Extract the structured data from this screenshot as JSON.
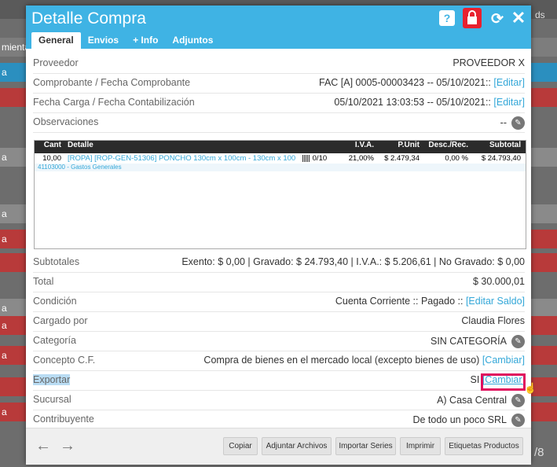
{
  "background": {
    "left_labels": [
      "mienta",
      "a",
      "a",
      "a",
      "a",
      "a",
      "a",
      "a",
      "a"
    ],
    "right_fragment": "/8",
    "row_fragment": "ds"
  },
  "dialog": {
    "title": "Detalle Compra",
    "tabs": [
      "General",
      "Envios",
      "+ Info",
      "Adjuntos"
    ],
    "active_tab": "General",
    "header_icons": [
      "help-icon",
      "lock-icon",
      "refresh-icon",
      "close-icon"
    ],
    "accent": "#3fb3e4"
  },
  "fields": {
    "proveedor": {
      "label": "Proveedor",
      "value": "PROVEEDOR X"
    },
    "comprobante": {
      "label": "Comprobante / Fecha Comprobante",
      "value": "FAC [A] 0005-00003423 -- 05/10/2021::",
      "link": "[Editar]"
    },
    "fecha_carga": {
      "label": "Fecha Carga / Fecha Contabilización",
      "value": "05/10/2021 13:03:53 -- 05/10/2021::",
      "link": "[Editar]"
    },
    "observaciones": {
      "label": "Observaciones",
      "value": "--"
    }
  },
  "grid": {
    "headers": [
      "Cant",
      "Detalle",
      "I.V.A.",
      "P.Unit",
      "Desc./Rec.",
      "Subtotal"
    ],
    "rows": [
      {
        "cant": "10,00",
        "detalle": "[ROPA] [ROP-GEN-51306] PONCHO 130cm x 100cm - 130cm x 100",
        "series": "0/10",
        "iva": "21,00%",
        "punit": "$ 2.479,34",
        "desc": "0,00 %",
        "subtotal": "$ 24.793,40",
        "cuenta": "41103000 - Gastos Generales"
      }
    ]
  },
  "summary": {
    "subtotales": {
      "label": "Subtotales",
      "value": "Exento: $ 0,00 | Gravado: $ 24.793,40 | I.V.A.: $ 5.206,61 | No Gravado: $ 0,00"
    },
    "total": {
      "label": "Total",
      "value": "$ 30.000,01"
    },
    "condicion": {
      "label": "Condición",
      "value": "Cuenta Corriente :: Pagado ::",
      "link": "[Editar Saldo]"
    },
    "cargado_por": {
      "label": "Cargado por",
      "value": "Claudia Flores"
    },
    "categoria": {
      "label": "Categoría",
      "value": "SIN CATEGORÍA"
    },
    "concepto": {
      "label": "Concepto C.F.",
      "value": "Compra de bienes en el mercado local (excepto bienes de uso)",
      "link": "[Cambiar]"
    },
    "exportar": {
      "label": "Exportar",
      "value": "SI",
      "link": "[Cambiar]"
    },
    "sucursal": {
      "label": "Sucursal",
      "value": "A) Casa Central"
    },
    "contribuyente": {
      "label": "Contribuyente",
      "value": "De todo un poco SRL"
    }
  },
  "footer": {
    "buttons": [
      "Copiar",
      "Adjuntar Archivos",
      "Importar Series",
      "Imprimir",
      "Etiquetas Productos"
    ]
  }
}
